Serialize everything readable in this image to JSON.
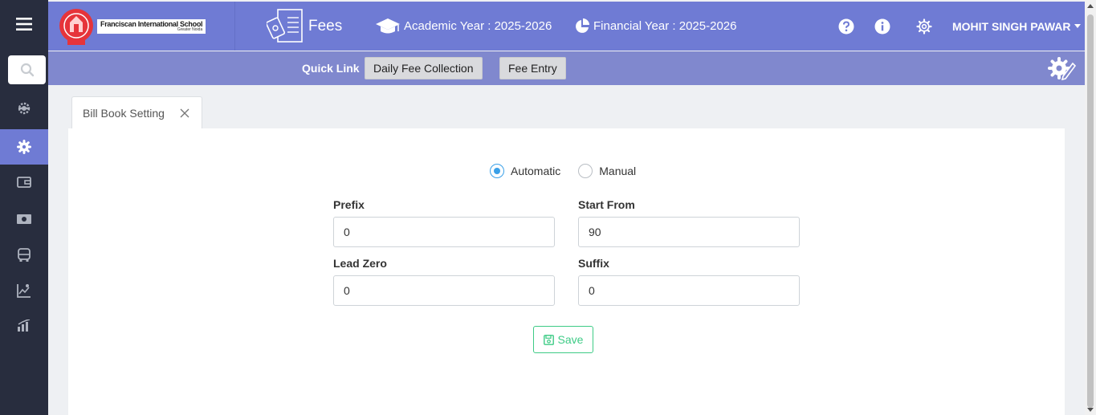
{
  "colors": {
    "sidebar_bg": "#282d3e",
    "header_bg": "#6f7bd4",
    "quickbar_bg": "#8088ce",
    "accent_radio": "#3aa0e8",
    "save_green": "#3ecb86"
  },
  "sidebar": {
    "items": [
      {
        "icon": "cog-badge-icon"
      },
      {
        "icon": "gear-icon",
        "active": true
      },
      {
        "icon": "wallet-icon"
      },
      {
        "icon": "cash-icon"
      },
      {
        "icon": "bus-icon"
      },
      {
        "icon": "chart-user-icon"
      },
      {
        "icon": "bar-chart-icon"
      }
    ]
  },
  "header": {
    "school_name": "Franciscan International School",
    "school_location": "Greater Noida",
    "module_title": "Fees",
    "academic_year": "Academic Year : 2025-2026",
    "financial_year": "Financial Year : 2025-2026",
    "user_name": "MOHIT SINGH PAWAR"
  },
  "quick_links": {
    "label": "Quick Link",
    "buttons": [
      "Daily Fee Collection",
      "Fee Entry"
    ]
  },
  "tab": {
    "label": "Bill Book Setting"
  },
  "form": {
    "mode_options": [
      "Automatic",
      "Manual"
    ],
    "selected_mode": "Automatic",
    "prefix_label": "Prefix",
    "prefix_value": "0",
    "start_from_label": "Start From",
    "start_from_value": "90",
    "lead_zero_label": "Lead Zero",
    "lead_zero_value": "0",
    "suffix_label": "Suffix",
    "suffix_value": "0",
    "save_label": "Save"
  }
}
